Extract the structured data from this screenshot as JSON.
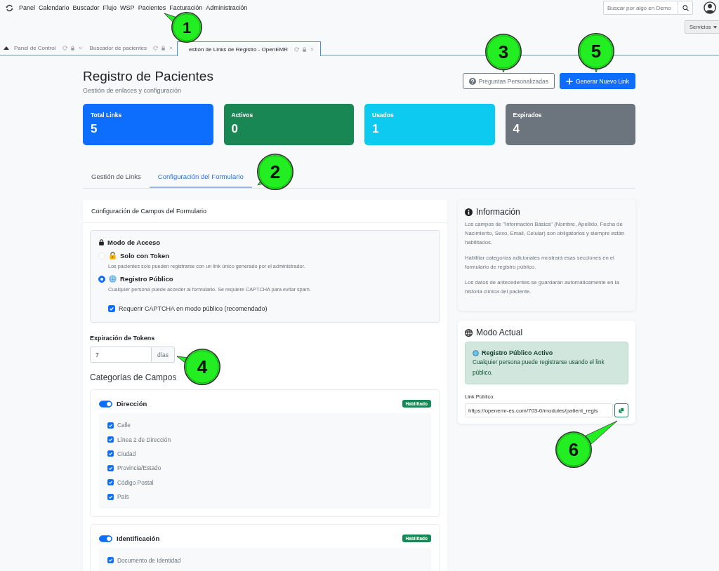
{
  "top_nav": {
    "items": [
      {
        "label": "Panel"
      },
      {
        "label": "Calendario"
      },
      {
        "label": "Buscador"
      },
      {
        "label": "Flujo"
      },
      {
        "label": "WSP"
      },
      {
        "label": "Pacientes"
      },
      {
        "label": "Facturación"
      },
      {
        "label": "Administración"
      }
    ],
    "search": {
      "placeholder": "Buscar por algo en Demo"
    },
    "services_button": "Servicios"
  },
  "tabs": [
    {
      "label": "Panel de Control",
      "selected": false
    },
    {
      "label": "Buscador de pacientes",
      "selected": false
    },
    {
      "label": "estión de Links de Registro - OpenEMR",
      "selected": true
    }
  ],
  "header": {
    "title": "Registro de Pacientes",
    "subtitle": "Gestión de enlaces y configuración",
    "buttons": [
      {
        "label": "Preguntas Personalizadas",
        "kind": "outline"
      },
      {
        "label": "Generar Nuevo Link",
        "kind": "primary"
      }
    ]
  },
  "stats": [
    {
      "label": "Total Links",
      "value": "5",
      "color": "#0d6efd"
    },
    {
      "label": "Activos",
      "value": "0",
      "color": "#198754"
    },
    {
      "label": "Usados",
      "value": "1",
      "color": "#0dcaf0"
    },
    {
      "label": "Expirados",
      "value": "4",
      "color": "#6c757d"
    }
  ],
  "section_tabs": [
    {
      "label": "Gestión de Links",
      "selected": false
    },
    {
      "label": "Configuración del Formulario",
      "selected": true
    }
  ],
  "form_card": {
    "title": "Configuración de Campos del Formulario",
    "access_mode": {
      "title": "Modo de Acceso",
      "options": [
        {
          "label": "Solo con Token",
          "description": "Los pacientes solo pueden registrarse con un link único generado por el administrador.",
          "selected": false
        },
        {
          "label": "Registro Público",
          "description": "Cualquier persona puede acceder al formulario. Se requiere CAPTCHA para evitar spam.",
          "selected": true
        }
      ],
      "captcha": {
        "label": "Requerir CAPTCHA en modo público (recomendado)",
        "checked": true
      }
    },
    "token_expiration": {
      "label": "Expiración de Tokens",
      "value": "7",
      "unit": "días"
    },
    "categories_title": "Categorías de Campos",
    "categories": [
      {
        "name": "Dirección",
        "on": true,
        "badge": "Habilitado",
        "fields": [
          {
            "label": "Calle",
            "checked": true
          },
          {
            "label": "Línea 2 de Dirección",
            "checked": true
          },
          {
            "label": "Ciudad",
            "checked": true
          },
          {
            "label": "Provincia/Estado",
            "checked": true
          },
          {
            "label": "Código Postal",
            "checked": true
          },
          {
            "label": "País",
            "checked": true
          }
        ]
      },
      {
        "name": "Identificación",
        "on": true,
        "badge": "Habilitado",
        "fields": [
          {
            "label": "Documento de Identidad",
            "checked": true
          }
        ]
      }
    ]
  },
  "info_card": {
    "title": "Información",
    "paragraphs": [
      "Los campos de \"Información Básica\" (Nombre, Apellido, Fecha de Nacimiento, Sexo, Email, Celular) son obligatorios y siempre están habilitados.",
      "Habilitar categorías adicionales mostrará esas secciones en el formulario de registro público.",
      "Los datos de antecedentes se guardarán automáticamente en la historia clínica del paciente."
    ]
  },
  "mode_card": {
    "title": "Modo Actual",
    "alert": {
      "title": "Registro Público Activo",
      "text": "Cualquier persona puede registrarse usando el link público."
    },
    "link_label": "Link Público:",
    "link_value": "https://openemr-es.com/703-0/modules/patient_regis"
  },
  "callouts": [
    {
      "label": "1"
    },
    {
      "label": "2"
    },
    {
      "label": "3"
    },
    {
      "label": "4"
    },
    {
      "label": "5"
    },
    {
      "label": "6"
    }
  ]
}
